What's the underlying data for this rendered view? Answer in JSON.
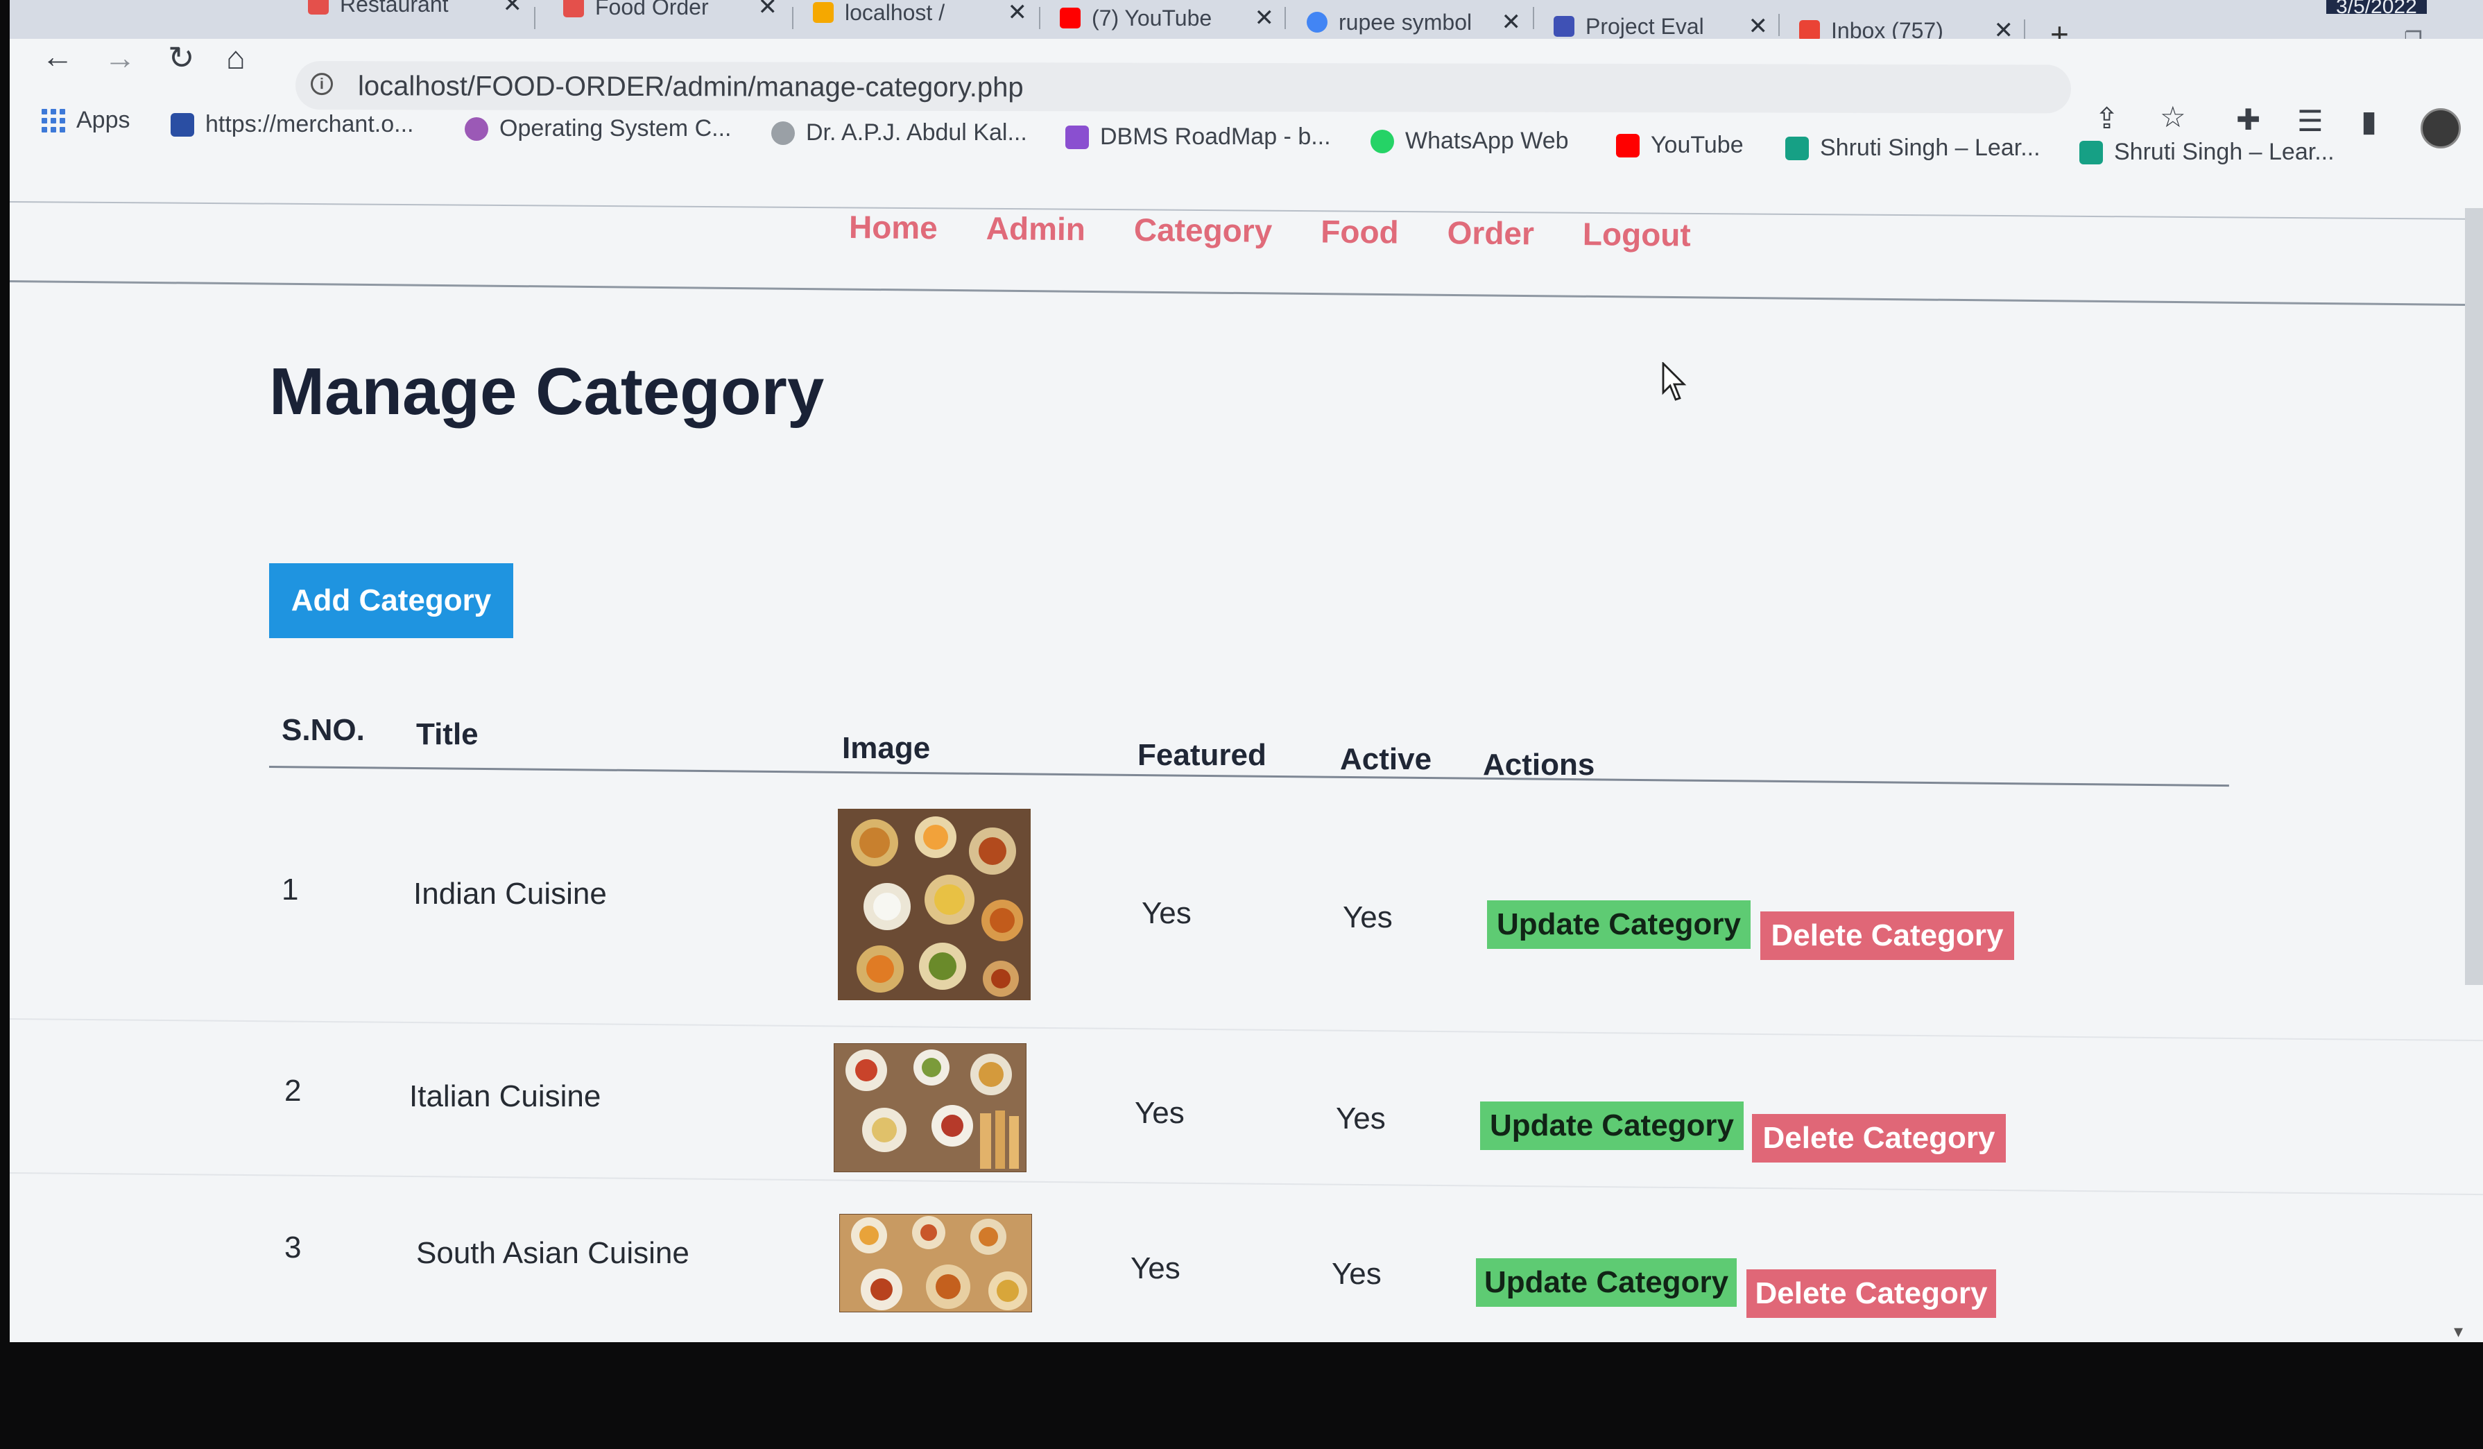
{
  "browser": {
    "tabs": [
      {
        "title": "Restaurant",
        "color": "#e4504b"
      },
      {
        "title": "Food Order",
        "color": "#e4504b"
      },
      {
        "title": "localhost /",
        "color": "#f5a800"
      },
      {
        "title": "(7) YouTube",
        "color": "#ff0000"
      },
      {
        "title": "rupee symbol",
        "color": "#4285f4"
      },
      {
        "title": "Project Eval",
        "color": "#3f51b5"
      },
      {
        "title": "Inbox (757)",
        "color": "#ea4335"
      }
    ],
    "system_date": "3/5/2022",
    "url": "localhost/FOOD-ORDER/admin/manage-category.php",
    "bookmarks": [
      {
        "label": "Apps",
        "color": "#3d79d8"
      },
      {
        "label": "https://merchant.o...",
        "color": "#2a4ea3"
      },
      {
        "label": "Operating System C...",
        "color": "#9b59b6"
      },
      {
        "label": "Dr. A.P.J. Abdul Kal...",
        "color": "#9aa0a6"
      },
      {
        "label": "DBMS RoadMap - b...",
        "color": "#8a4fd0"
      },
      {
        "label": "WhatsApp Web",
        "color": "#25d366"
      },
      {
        "label": "YouTube",
        "color": "#ff0000"
      },
      {
        "label": "Shruti Singh – Lear...",
        "color": "#16a085"
      },
      {
        "label": "Shruti Singh – Lear...",
        "color": "#16a085"
      }
    ]
  },
  "nav": {
    "items": [
      "Home",
      "Admin",
      "Category",
      "Food",
      "Order",
      "Logout"
    ],
    "color": "#e06b7a"
  },
  "page": {
    "title": "Manage Category",
    "add_button": "Add Category"
  },
  "table": {
    "headers": [
      "S.NO.",
      "Title",
      "Image",
      "Featured",
      "Active",
      "Actions"
    ],
    "rows": [
      {
        "sno": "1",
        "title": "Indian Cuisine",
        "featured": "Yes",
        "active": "Yes",
        "update": "Update Category",
        "delete": "Delete Category"
      },
      {
        "sno": "2",
        "title": "Italian Cuisine",
        "featured": "Yes",
        "active": "Yes",
        "update": "Update Category",
        "delete": "Delete Category"
      },
      {
        "sno": "3",
        "title": "South Asian Cuisine",
        "featured": "Yes",
        "active": "Yes",
        "update": "Update Category",
        "delete": "Delete Category"
      }
    ]
  },
  "colors": {
    "update_button": "#5ecb73",
    "delete_button": "#e06777",
    "add_button": "#1f94e0"
  }
}
